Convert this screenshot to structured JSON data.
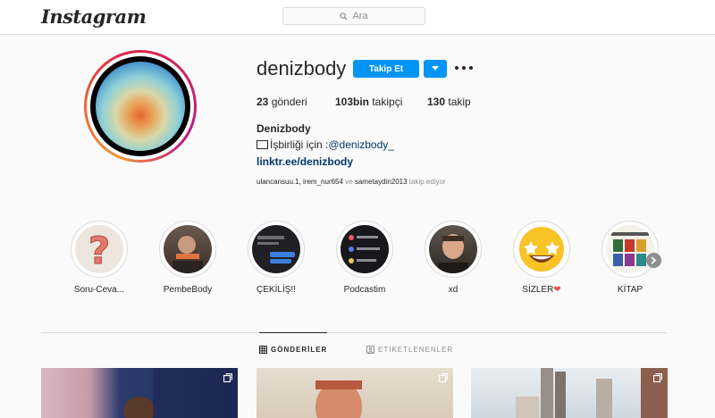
{
  "header": {
    "logo": "Instagram",
    "search_placeholder": "Ara"
  },
  "profile": {
    "username": "denizbody",
    "follow_label": "Takip Et",
    "stats": {
      "posts_count": "23",
      "posts_label": " gönderi",
      "followers_count": "103bin",
      "followers_label": " takipçi",
      "following_count": "130",
      "following_label": " takip"
    },
    "full_name": "Denizbody",
    "bio_prefix": "İşbirliği için : ",
    "bio_mention": "@denizbody_",
    "link": "linktr.ee/denizbody",
    "followed_by": {
      "users": "ulancansuu.1, irem_nur654",
      "conjunction": " ve ",
      "last_user": "sametaydin2013",
      "suffix": " takip ediyor"
    }
  },
  "highlights": [
    {
      "label": "Soru-Ceva...",
      "icon": "question-mark"
    },
    {
      "label": "PembeBody",
      "icon": "person-photo"
    },
    {
      "label": "ÇEKİLİŞ!!",
      "icon": "chat-screenshot"
    },
    {
      "label": "Podcastim",
      "icon": "podcast-screenshot"
    },
    {
      "label": "xd",
      "icon": "person-photo"
    },
    {
      "label": "SİZLER",
      "icon": "star-struck-emoji",
      "suffix_icon": "red-heart"
    },
    {
      "label": "KİTAP",
      "icon": "book-collage"
    }
  ],
  "tabs": [
    {
      "label": "GÖNDERİLER",
      "active": true,
      "icon": "grid-icon"
    },
    {
      "label": "ETİKETLENENLER",
      "active": false,
      "icon": "tagged-icon"
    }
  ],
  "colors": {
    "accent": "#0095f6",
    "link": "#00376b",
    "heart": "#ed4956"
  }
}
